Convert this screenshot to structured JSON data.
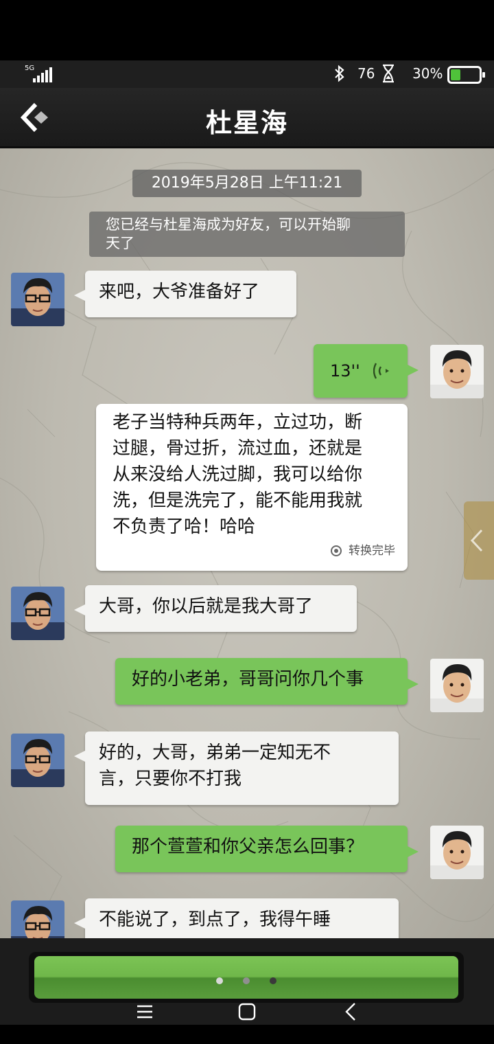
{
  "status_bar": {
    "network": "5G",
    "data_rate": "76",
    "battery_percent": "30%",
    "battery_level": 0.3,
    "battery_color": "#4fc23a"
  },
  "header": {
    "title": "杜星海",
    "back_icon": "back-arrow-icon"
  },
  "chat": {
    "timestamp": "2019年5月28日 上午11:21",
    "system_notice_line1": "您已经与杜星海成为好友，可以开始聊",
    "system_notice_line2": "天了",
    "messages": [
      {
        "side": "in",
        "text": "来吧，大爷准备好了"
      },
      {
        "side": "out",
        "type": "voice",
        "duration": "13''"
      },
      {
        "side": "transcript",
        "lines": [
          "老子当特种兵两年，立过功，断",
          "过腿，骨过折，流过血，还就是",
          "从来没给人洗过脚，我可以给你",
          "洗，但是洗完了，能不能用我就",
          "不负责了哈！哈哈"
        ],
        "status": "转换完毕"
      },
      {
        "side": "in",
        "text": "大哥，你以后就是我大哥了"
      },
      {
        "side": "out",
        "text": "好的小老弟，哥哥问你几个事"
      },
      {
        "side": "in",
        "lines": [
          "好的，大哥，弟弟一定知无不",
          "言，只要你不打我"
        ]
      },
      {
        "side": "out",
        "text": "那个萱萱和你父亲怎么回事？"
      },
      {
        "side": "in",
        "text": "不能说了，到点了，我得午睡"
      }
    ]
  },
  "input_bar": {
    "page_indicator_count": 3,
    "page_indicator_active": 3
  },
  "colors": {
    "outgoing_bubble": "#79c55a",
    "incoming_bubble": "#f3f3f1",
    "header_bg": "#1f1f1f"
  }
}
